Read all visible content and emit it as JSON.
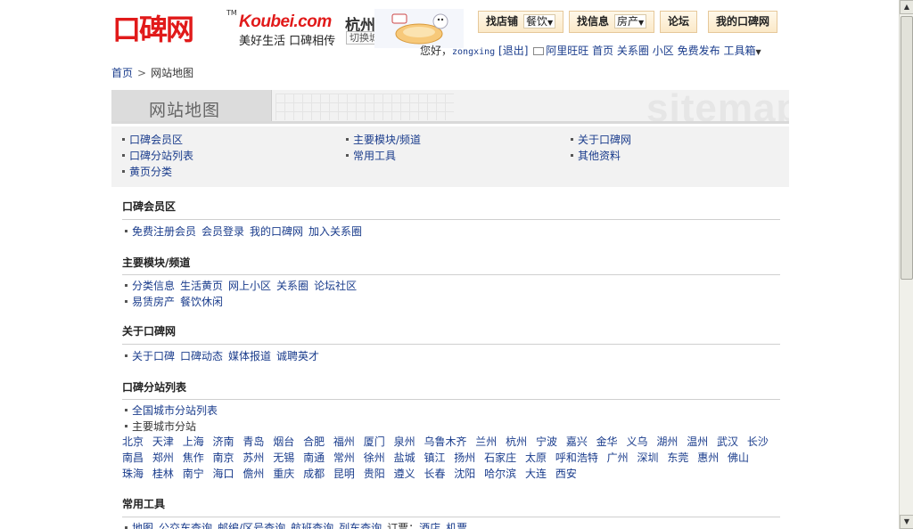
{
  "header": {
    "logo_cn": "口碑网",
    "logo_tm": "TM",
    "logo_en": "Koubei.com",
    "city": "杭州",
    "slogan": "美好生活 口碑相传",
    "switch_city": "切换城市"
  },
  "nav": {
    "find_shop": "找店铺",
    "find_shop_dd": "餐饮",
    "find_info": "找信息",
    "find_info_dd": "房产",
    "forum": "论坛",
    "my_koubei": "我的口碑网"
  },
  "userbar": {
    "greeting": "您好，",
    "username": "zongxing",
    "logout": "[退出]",
    "aliww": "阿里旺旺",
    "home": "首页",
    "circle": "关系圈",
    "community": "小区",
    "free_post": "免费发布",
    "toolbox": "工具箱"
  },
  "breadcrumb": {
    "home": "首页",
    "sep": ">",
    "current": "网站地图"
  },
  "banner": {
    "title": "网站地图",
    "deco": "sitemap"
  },
  "index": [
    {
      "label": "口碑会员区"
    },
    {
      "label": "主要模块/频道"
    },
    {
      "label": "关于口碑网"
    },
    {
      "label": "口碑分站列表"
    },
    {
      "label": "常用工具"
    },
    {
      "label": "其他资料"
    },
    {
      "label": "黄页分类"
    }
  ],
  "sections": {
    "member": {
      "title": "口碑会员区",
      "links": [
        "免费注册会员",
        "会员登录",
        "我的口碑网",
        "加入关系圈"
      ]
    },
    "modules": {
      "title": "主要模块/频道",
      "row1": [
        "分类信息",
        "生活黄页",
        "网上小区",
        "关系圈",
        "论坛社区"
      ],
      "row2": [
        "易赁房产",
        "餐饮休闲"
      ]
    },
    "about": {
      "title": "关于口碑网",
      "links": [
        "关于口碑",
        "口碑动态",
        "媒体报道",
        "诚聘英才"
      ]
    },
    "substations": {
      "title": "口碑分站列表",
      "all_cities": "全国城市分站列表",
      "main_cities": "主要城市分站",
      "cities": [
        "北京",
        "天津",
        "上海",
        "济南",
        "青岛",
        "烟台",
        "合肥",
        "福州",
        "厦门",
        "泉州",
        "乌鲁木齐",
        "兰州",
        "杭州",
        "宁波",
        "嘉兴",
        "金华",
        "义乌",
        "湖州",
        "温州",
        "武汉",
        "长沙",
        "南昌",
        "郑州",
        "焦作",
        "南京",
        "苏州",
        "无锡",
        "南通",
        "常州",
        "徐州",
        "盐城",
        "镇江",
        "扬州",
        "石家庄",
        "太原",
        "呼和浩特",
        "广州",
        "深圳",
        "东莞",
        "惠州",
        "佛山",
        "珠海",
        "桂林",
        "南宁",
        "海口",
        "儋州",
        "重庆",
        "成都",
        "昆明",
        "贵阳",
        "遵义",
        "长春",
        "沈阳",
        "哈尔滨",
        "大连",
        "西安"
      ]
    },
    "tools": {
      "title": "常用工具",
      "links": [
        "地图",
        "公交车查询",
        "邮编/区号查询",
        "航班查询",
        "列车查询"
      ],
      "label": "订票：",
      "links2": [
        "酒店",
        "机票"
      ]
    }
  },
  "colors": {
    "brand_red": "#e11a1a",
    "link_blue": "#1a3c8c"
  }
}
